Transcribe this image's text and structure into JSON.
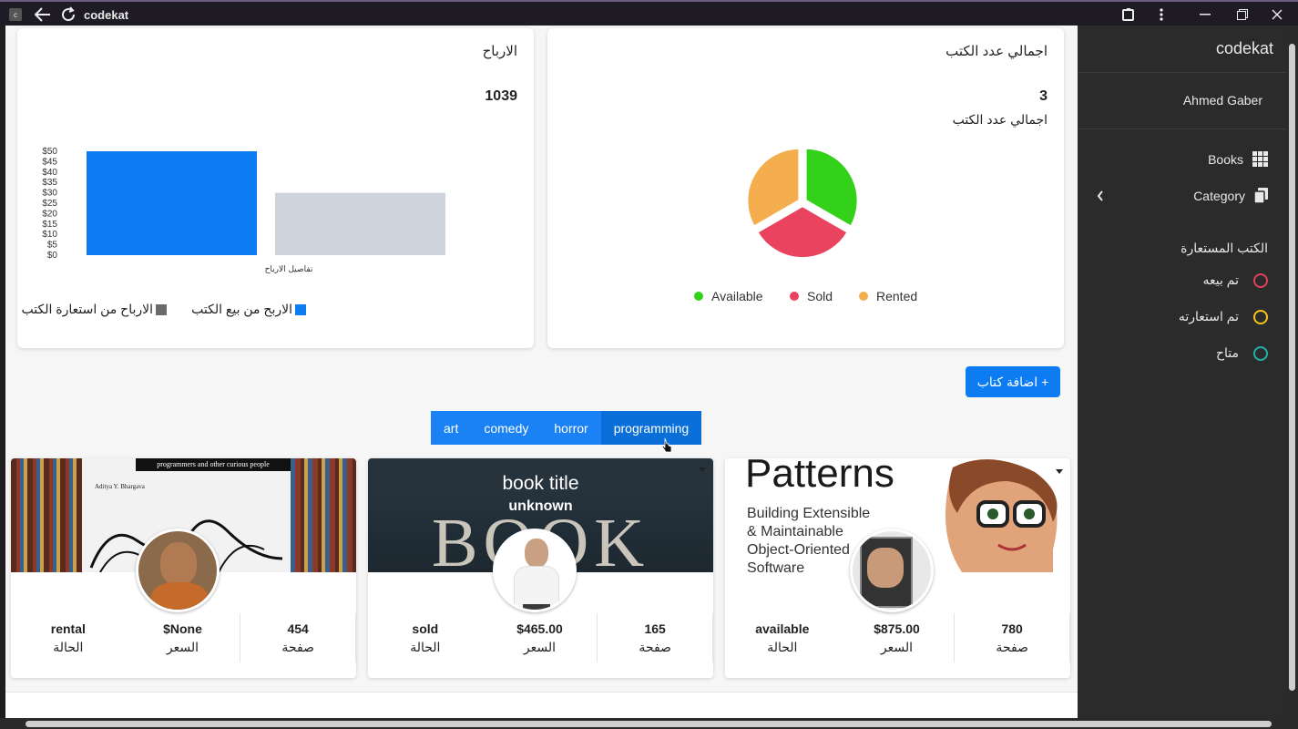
{
  "window": {
    "title": "codekat",
    "app_icon": "c"
  },
  "sidebar": {
    "brand": "codekat",
    "user": "Ahmed Gaber",
    "nav": [
      {
        "label": "Books",
        "icon": "grid-icon"
      },
      {
        "label": "Category",
        "icon": "copy-icon"
      }
    ],
    "section_title": "الكتب المستعارة",
    "statuses": [
      {
        "label": "تم بيعه",
        "color": "#e0405a"
      },
      {
        "label": "تم استعارته",
        "color": "#f5c518"
      },
      {
        "label": "متاح",
        "color": "#20b2aa"
      }
    ]
  },
  "profits_card": {
    "title": "الارباح",
    "total": "1039",
    "legend": [
      "الاربح من بيع الكتب",
      "الارباح من استعارة الكتب"
    ]
  },
  "books_card": {
    "title": "اجمالي عدد الكتب",
    "total": "3",
    "subtitle": "اجمالي عدد الكتب",
    "legend": [
      {
        "label": "Available",
        "color": "#33d119"
      },
      {
        "label": "Sold",
        "color": "#e9435f"
      },
      {
        "label": "Rented",
        "color": "#f4ae4e"
      }
    ]
  },
  "chart_data": [
    {
      "type": "bar",
      "categories": [
        "تفاصيل الارباح"
      ],
      "xlabel": "تفاصيل الارباح",
      "series": [
        {
          "name": "الاربح من بيع الكتب",
          "values": [
            50
          ],
          "color": "#0d7cf2"
        },
        {
          "name": "الارباح من استعارة الكتب",
          "values": [
            30
          ],
          "color": "#cfd4dc"
        }
      ],
      "ylim": [
        0,
        50
      ],
      "yticks": [
        "$0",
        "$5",
        "$10",
        "$15",
        "$20",
        "$25",
        "$30",
        "$35",
        "$40",
        "$45",
        "$50"
      ]
    },
    {
      "type": "pie",
      "labels": [
        "Available",
        "Sold",
        "Rented"
      ],
      "values": [
        1,
        1,
        1
      ],
      "colors": [
        "#33d119",
        "#e9435f",
        "#f4ae4e"
      ]
    }
  ],
  "add_button": "+ اضافة كتاب",
  "tabs": [
    "art",
    "comedy",
    "horror",
    "programming"
  ],
  "active_tab": "programming",
  "books": [
    {
      "pages": "454",
      "pages_label": "صفحة",
      "price": "None$",
      "price_label": "السعر",
      "status": "rental",
      "status_label": "الحالة",
      "cover_text": "programmers and other curious people",
      "author_line": "Aditya Y. Bhargava",
      "cover_bg": "#f2f2f2"
    },
    {
      "pages": "165",
      "pages_label": "صفحة",
      "price": "$465.00",
      "price_label": "السعر",
      "status": "sold",
      "status_label": "الحالة",
      "cover_title": "book title",
      "cover_author": "unknown",
      "cover_big": "BOOK",
      "cover_bg": "#26333d"
    },
    {
      "pages": "780",
      "pages_label": "صفحة",
      "price": "$875.00",
      "price_label": "السعر",
      "status": "available",
      "status_label": "الحالة",
      "cover_big": "Patterns",
      "cover_lines": [
        "Building Extensible",
        "& Maintainable",
        "Object-Oriented",
        "Software"
      ],
      "cover_bg": "#ffffff"
    }
  ]
}
